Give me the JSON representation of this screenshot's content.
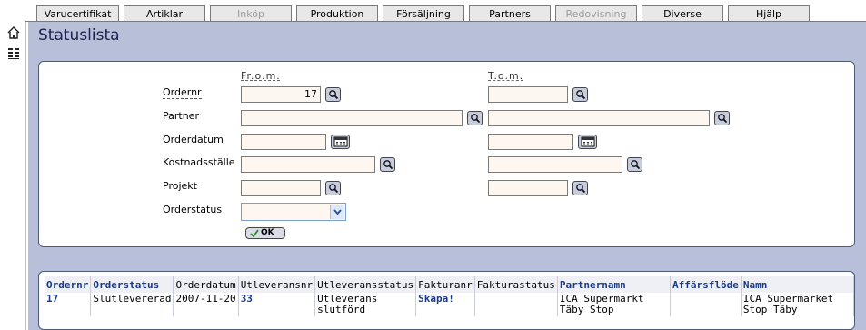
{
  "menu": {
    "tabs": [
      {
        "label": "Varucertifikat",
        "disabled": false
      },
      {
        "label": "Artiklar",
        "disabled": false
      },
      {
        "label": "Inköp",
        "disabled": true
      },
      {
        "label": "Produktion",
        "disabled": false
      },
      {
        "label": "Försäljning",
        "disabled": false
      },
      {
        "label": "Partners",
        "disabled": false
      },
      {
        "label": "Redovisning",
        "disabled": true
      },
      {
        "label": "Diverse",
        "disabled": false
      },
      {
        "label": "Hjälp",
        "disabled": false
      }
    ]
  },
  "sidebar": {
    "icons": [
      "home-icon",
      "list-icon"
    ]
  },
  "page": {
    "title": "Statuslista"
  },
  "form": {
    "from_label": "Fr.o.m.",
    "to_label": "T.o.m.",
    "fields": {
      "ordernr": {
        "label": "Ordernr",
        "from_value": "17",
        "to_value": ""
      },
      "partner": {
        "label": "Partner",
        "from_value": "",
        "to_value": ""
      },
      "orderdatum": {
        "label": "Orderdatum",
        "from_value": "",
        "to_value": ""
      },
      "kostnadsstalle": {
        "label": "Kostnadsställe",
        "from_value": "",
        "to_value": ""
      },
      "projekt": {
        "label": "Projekt",
        "from_value": "",
        "to_value": ""
      },
      "orderstatus": {
        "label": "Orderstatus",
        "selected": ""
      }
    },
    "ok_label": "OK"
  },
  "results": {
    "headers": [
      "Ordernr",
      "Orderstatus",
      "Orderdatum",
      "Utleveransnr",
      "Utleveransstatus",
      "Fakturanr",
      "Fakturastatus",
      "Partnernamn",
      "Affärsflöde",
      "Namn"
    ],
    "rows": [
      [
        "17",
        "Slutlevererad",
        "2007-11-20",
        "33",
        "Utleverans slutförd",
        "Skapa!",
        "",
        "ICA Supermarkt Täby Stop",
        "",
        "ICA Supermarket Stop Täby"
      ]
    ]
  }
}
